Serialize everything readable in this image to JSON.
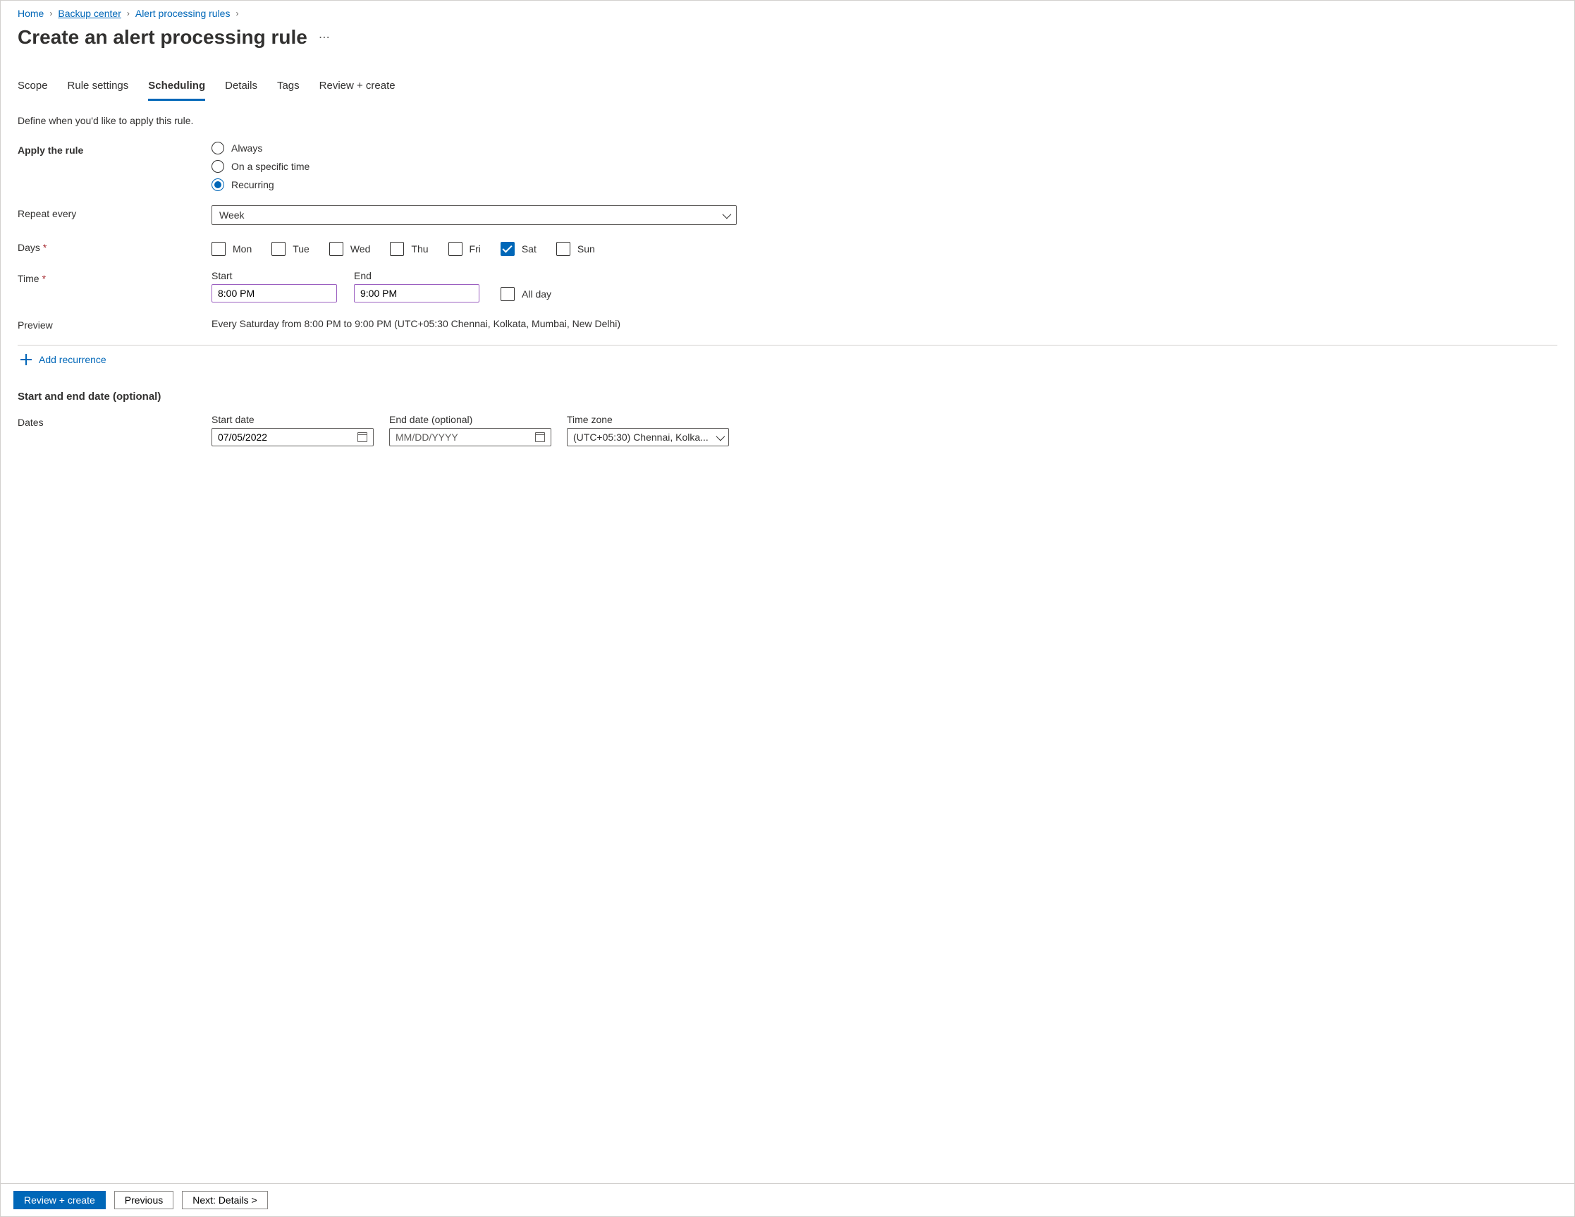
{
  "breadcrumb": {
    "items": [
      {
        "label": "Home"
      },
      {
        "label": "Backup center"
      },
      {
        "label": "Alert processing rules"
      }
    ]
  },
  "page_title": "Create an alert processing rule",
  "tabs": {
    "items": [
      {
        "label": "Scope",
        "active": false
      },
      {
        "label": "Rule settings",
        "active": false
      },
      {
        "label": "Scheduling",
        "active": true
      },
      {
        "label": "Details",
        "active": false
      },
      {
        "label": "Tags",
        "active": false
      },
      {
        "label": "Review + create",
        "active": false
      }
    ]
  },
  "intro": "Define when you'd like to apply this rule.",
  "apply_rule": {
    "label": "Apply the rule",
    "options": [
      {
        "label": "Always",
        "selected": false
      },
      {
        "label": "On a specific time",
        "selected": false
      },
      {
        "label": "Recurring",
        "selected": true
      }
    ]
  },
  "repeat": {
    "label": "Repeat every",
    "value": "Week"
  },
  "days": {
    "label": "Days",
    "items": [
      {
        "label": "Mon",
        "checked": false
      },
      {
        "label": "Tue",
        "checked": false
      },
      {
        "label": "Wed",
        "checked": false
      },
      {
        "label": "Thu",
        "checked": false
      },
      {
        "label": "Fri",
        "checked": false
      },
      {
        "label": "Sat",
        "checked": true
      },
      {
        "label": "Sun",
        "checked": false
      }
    ]
  },
  "time": {
    "label": "Time",
    "start_label": "Start",
    "start_value": "8:00 PM",
    "end_label": "End",
    "end_value": "9:00 PM",
    "allday_label": "All day",
    "allday_checked": false
  },
  "preview": {
    "label": "Preview",
    "text": "Every Saturday from 8:00 PM to 9:00 PM (UTC+05:30 Chennai, Kolkata, Mumbai, New Delhi)"
  },
  "add_recurrence": "Add recurrence",
  "dates_section": {
    "heading": "Start and end date (optional)",
    "label": "Dates",
    "start_label": "Start date",
    "start_value": "07/05/2022",
    "end_label": "End date (optional)",
    "end_placeholder": "MM/DD/YYYY",
    "tz_label": "Time zone",
    "tz_value": "(UTC+05:30) Chennai, Kolka..."
  },
  "footer": {
    "primary": "Review + create",
    "previous": "Previous",
    "next": "Next: Details >"
  }
}
